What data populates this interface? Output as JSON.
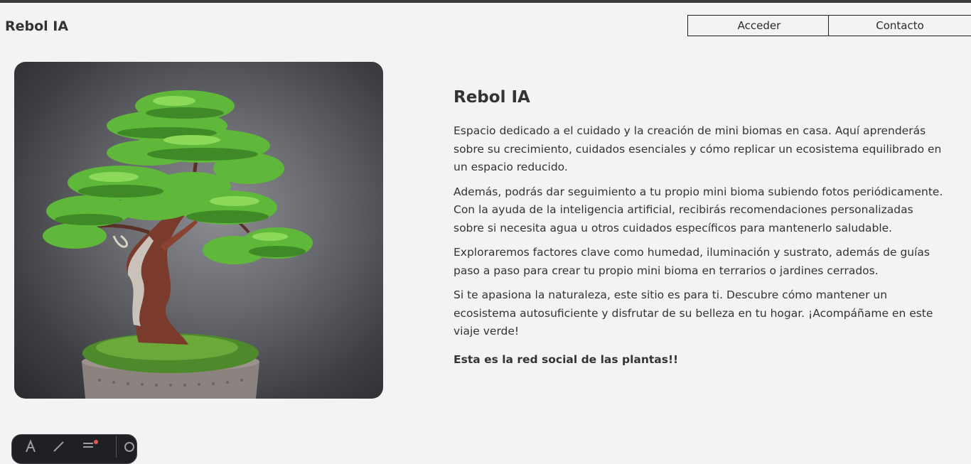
{
  "header": {
    "brand": "Rebol IA",
    "nav": [
      {
        "label": "Acceder"
      },
      {
        "label": "Contacto"
      }
    ]
  },
  "hero": {
    "image": {
      "subject": "bonsai-tree",
      "background_color": "#5a5b60"
    }
  },
  "main": {
    "title": "Rebol IA",
    "paragraphs": [
      "Espacio dedicado a el cuidado y la creación de mini biomas en casa. Aquí aprenderás sobre su crecimiento, cuidados esenciales y cómo replicar un ecosistema equilibrado en un espacio reducido.",
      "Además, podrás dar seguimiento a tu propio mini bioma subiendo fotos periódicamente. Con la ayuda de la inteligencia artificial, recibirás recomendaciones personalizadas sobre si necesita agua u otros cuidados específicos para mantenerlo saludable.",
      "Exploraremos factores clave como humedad, iluminación y sustrato, además de guías paso a paso para crear tu propio mini bioma en terrarios o jardines cerrados.",
      "Si te apasiona la naturaleza, este sitio es para ti. Descubre cómo mantener un ecosistema autosuficiente y disfrutar de su belleza en tu hogar. ¡Acompáñame en este viaje verde!"
    ],
    "closing": "Esta es la red social de las plantas!!"
  },
  "dock": {
    "items": [
      {
        "icon": "text-icon"
      },
      {
        "icon": "brush-icon"
      },
      {
        "icon": "menu-icon"
      },
      {
        "icon": "settings-icon"
      }
    ]
  },
  "colors": {
    "page_background": "#f3f3f3",
    "text": "#333333",
    "border": "#1e1e1e",
    "foliage": "#5fb83a"
  }
}
